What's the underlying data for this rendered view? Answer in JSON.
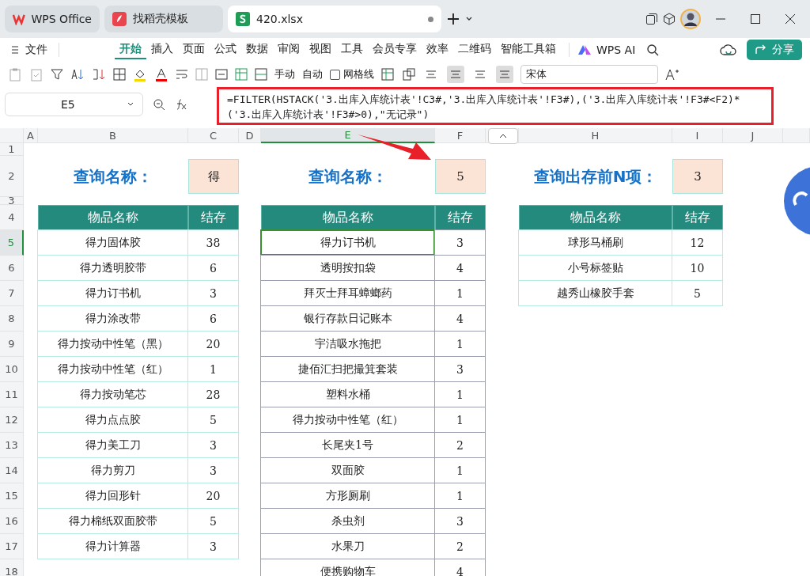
{
  "tabs": [
    {
      "label": "WPS Office",
      "kind": "home",
      "selected": false
    },
    {
      "label": "找稻壳模板",
      "kind": "template",
      "selected": false
    },
    {
      "label": "420.xlsx",
      "kind": "sheet",
      "selected": true
    }
  ],
  "menu": {
    "file": "文件",
    "items": [
      {
        "label": "开始",
        "selected": true
      },
      {
        "label": "插入",
        "selected": false
      },
      {
        "label": "页面",
        "selected": false
      },
      {
        "label": "公式",
        "selected": false
      },
      {
        "label": "数据",
        "selected": false
      },
      {
        "label": "审阅",
        "selected": false
      },
      {
        "label": "视图",
        "selected": false
      },
      {
        "label": "工具",
        "selected": false
      },
      {
        "label": "会员专享",
        "selected": false
      },
      {
        "label": "效率",
        "selected": false
      },
      {
        "label": "二维码",
        "selected": false
      },
      {
        "label": "智能工具箱",
        "selected": false
      }
    ],
    "ai": "WPS AI",
    "share": "分享"
  },
  "toolbar": {
    "row_height": "手动",
    "col_width": "自动",
    "gridlines": {
      "label": "网格线",
      "checked": false
    },
    "align_buttons": [
      {
        "selected": false
      },
      {
        "selected": true
      },
      {
        "selected": false
      },
      {
        "selected": true
      }
    ],
    "font": "宋体"
  },
  "formula_bar": {
    "cell": "E5",
    "formula": "=FILTER(HSTACK('3.出库入库统计表'!C3#,'3.出库入库统计表'!F3#),('3.出库入库统计表'!F3#<F2)*('3.出库入库统计表'!F3#>0),\"无记录\")"
  },
  "sheet": {
    "columns": [
      {
        "label": "A",
        "selected": false
      },
      {
        "label": "B",
        "selected": false
      },
      {
        "label": "C",
        "selected": false
      },
      {
        "label": "D",
        "selected": false
      },
      {
        "label": "E",
        "selected": true
      },
      {
        "label": "F",
        "selected": false
      },
      {
        "label": "H",
        "selected": false
      },
      {
        "label": "I",
        "selected": false
      },
      {
        "label": "J",
        "selected": false
      }
    ],
    "rows": [
      {
        "label": "1",
        "selected": false
      },
      {
        "label": "2",
        "selected": false
      },
      {
        "label": "3",
        "selected": false
      },
      {
        "label": "4",
        "selected": false
      },
      {
        "label": "5",
        "selected": true
      },
      {
        "label": "6",
        "selected": false
      },
      {
        "label": "7",
        "selected": false
      },
      {
        "label": "8",
        "selected": false
      },
      {
        "label": "9",
        "selected": false
      },
      {
        "label": "10",
        "selected": false
      },
      {
        "label": "11",
        "selected": false
      },
      {
        "label": "12",
        "selected": false
      },
      {
        "label": "13",
        "selected": false
      },
      {
        "label": "14",
        "selected": false
      },
      {
        "label": "15",
        "selected": false
      },
      {
        "label": "16",
        "selected": false
      },
      {
        "label": "17",
        "selected": false
      },
      {
        "label": "18",
        "selected": false
      }
    ],
    "tables": [
      {
        "label": "查询名称：",
        "value": "得",
        "headers": [
          "物品名称",
          "结存"
        ],
        "rows": [
          [
            "得力固体胶",
            "38"
          ],
          [
            "得力透明胶带",
            "6"
          ],
          [
            "得力订书机",
            "3"
          ],
          [
            "得力涂改带",
            "6"
          ],
          [
            "得力按动中性笔（黑）",
            "20"
          ],
          [
            "得力按动中性笔（红）",
            "1"
          ],
          [
            "得力按动笔芯",
            "28"
          ],
          [
            "得力点点胶",
            "5"
          ],
          [
            "得力美工刀",
            "3"
          ],
          [
            "得力剪刀",
            "3"
          ],
          [
            "得力回形针",
            "20"
          ],
          [
            "得力棉纸双面胶带",
            "5"
          ],
          [
            "得力计算器",
            "3"
          ]
        ]
      },
      {
        "label": "查询名称：",
        "value": "5",
        "headers": [
          "物品名称",
          "结存"
        ],
        "rows": [
          [
            "得力订书机",
            "3"
          ],
          [
            "透明按扣袋",
            "4"
          ],
          [
            "拜灭士拜耳蟑螂药",
            "1"
          ],
          [
            "银行存款日记账本",
            "4"
          ],
          [
            "宇洁吸水拖把",
            "1"
          ],
          [
            "捷佰汇扫把撮箕套装",
            "3"
          ],
          [
            "塑料水桶",
            "1"
          ],
          [
            "得力按动中性笔（红）",
            "1"
          ],
          [
            "长尾夹1号",
            "2"
          ],
          [
            "双面胶",
            "1"
          ],
          [
            "方形厕刷",
            "1"
          ],
          [
            "杀虫剂",
            "3"
          ],
          [
            "水果刀",
            "2"
          ],
          [
            "便携购物车",
            "4"
          ]
        ]
      },
      {
        "label": "查询出存前N项：",
        "value": "3",
        "headers": [
          "物品名称",
          "结存"
        ],
        "rows": [
          [
            "球形马桶刷",
            "12"
          ],
          [
            "小号标签贴",
            "10"
          ],
          [
            "越秀山橡胶手套",
            "5"
          ]
        ]
      }
    ]
  }
}
